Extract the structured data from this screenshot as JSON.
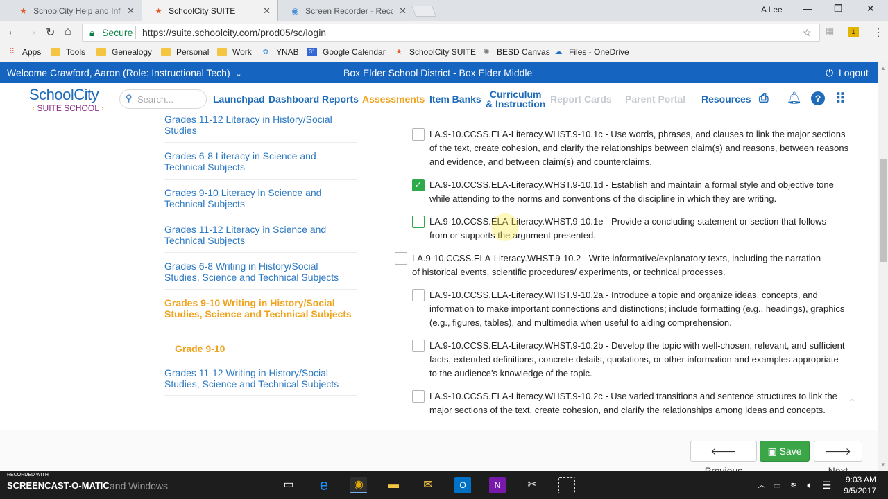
{
  "browser": {
    "tabs": [
      {
        "title": "SchoolCity Help and Info",
        "icon": "schoolcity-icon"
      },
      {
        "title": "SchoolCity SUITE",
        "icon": "schoolcity-icon"
      },
      {
        "title": "Screen Recorder - Reco",
        "icon": "recorder-icon"
      }
    ],
    "user": "A Lee",
    "address": {
      "secure_label": "Secure",
      "url": "https://suite.schoolcity.com/prod05/sc/login"
    },
    "bookmarks": [
      "Apps",
      "Tools",
      "Genealogy",
      "Personal",
      "Work",
      "YNAB",
      "Google Calendar",
      "SchoolCity SUITE",
      "BESD Canvas",
      "Files - OneDrive"
    ]
  },
  "header": {
    "welcome": "Welcome Crawford, Aaron (Role: Instructional Tech)",
    "district": "Box Elder School District - Box Elder Middle",
    "logout": "Logout"
  },
  "logo": {
    "line1": "SchoolCity",
    "line2": "SUITE SCHOOL"
  },
  "search": {
    "placeholder": "Search..."
  },
  "nav": {
    "launchpad": "Launchpad",
    "dashboard_reports": "Dashboard Reports",
    "assessments": "Assessments",
    "item_banks": "Item Banks",
    "curriculum_line1": "Curriculum",
    "curriculum_line2": "& Instruction",
    "report_cards": "Report Cards",
    "parent_portal": "Parent Portal",
    "resources": "Resources"
  },
  "left_list": [
    "Grades 11-12 Literacy in History/Social Studies",
    "Grades 6-8 Literacy in Science and Technical Subjects",
    "Grades 9-10 Literacy in Science and Technical Subjects",
    "Grades 11-12 Literacy in Science and Technical Subjects",
    "Grades 6-8 Writing in History/Social Studies, Science and Technical Subjects",
    "Grades 9-10 Writing in History/Social Studies, Science and Technical Subjects",
    "Grade 9-10",
    "Grades 11-12 Writing in History/Social Studies, Science and Technical Subjects"
  ],
  "standards": [
    {
      "text": "LA.9-10.CCSS.ELA-Literacy.WHST.9-10.1c - Use words, phrases, and clauses to link the major sections of the text, create cohesion, and clarify the relationships between claim(s) and reasons, between reasons and evidence, and between claim(s) and counterclaims.",
      "checked": false
    },
    {
      "text": "LA.9-10.CCSS.ELA-Literacy.WHST.9-10.1d - Establish and maintain a formal style and objective tone while attending to the norms and conventions of the discipline in which they are writing.",
      "checked": true
    },
    {
      "text": "LA.9-10.CCSS.ELA-Literacy.WHST.9-10.1e - Provide a concluding statement or section that follows from or supports the argument presented.",
      "checked": false
    },
    {
      "text": "LA.9-10.CCSS.ELA-Literacy.WHST.9-10.2 - Write informative/explanatory texts, including the narration of historical events, scientific procedures/ experiments, or technical processes.",
      "checked": false
    },
    {
      "text": "LA.9-10.CCSS.ELA-Literacy.WHST.9-10.2a - Introduce a topic and organize ideas, concepts, and information to make important connections and distinctions; include formatting (e.g., headings), graphics (e.g., figures, tables), and multimedia when useful to aiding comprehension.",
      "checked": false
    },
    {
      "text": "LA.9-10.CCSS.ELA-Literacy.WHST.9-10.2b - Develop the topic with well-chosen, relevant, and sufficient facts, extended definitions, concrete details, quotations, or other information and examples appropriate to the audience’s knowledge of the topic.",
      "checked": false
    },
    {
      "text": "LA.9-10.CCSS.ELA-Literacy.WHST.9-10.2c - Use varied transitions and sentence structures to link the major sections of the text, create cohesion, and clarify the relationships among ideas and concepts.",
      "checked": false
    }
  ],
  "footer": {
    "previous": "Previous",
    "save": "Save",
    "next": "Next"
  },
  "watermark": {
    "recorded_with": "RECORDED WITH",
    "brand": "SCREENCAST-O-MATIC",
    "tail": "and Windows"
  },
  "clock": {
    "time": "9:03 AM",
    "date": "9/5/2017"
  },
  "colors": {
    "brand_blue": "#1565c0",
    "link_blue": "#2a78c2",
    "orange": "#f0a31c",
    "green": "#2eaa4b"
  }
}
